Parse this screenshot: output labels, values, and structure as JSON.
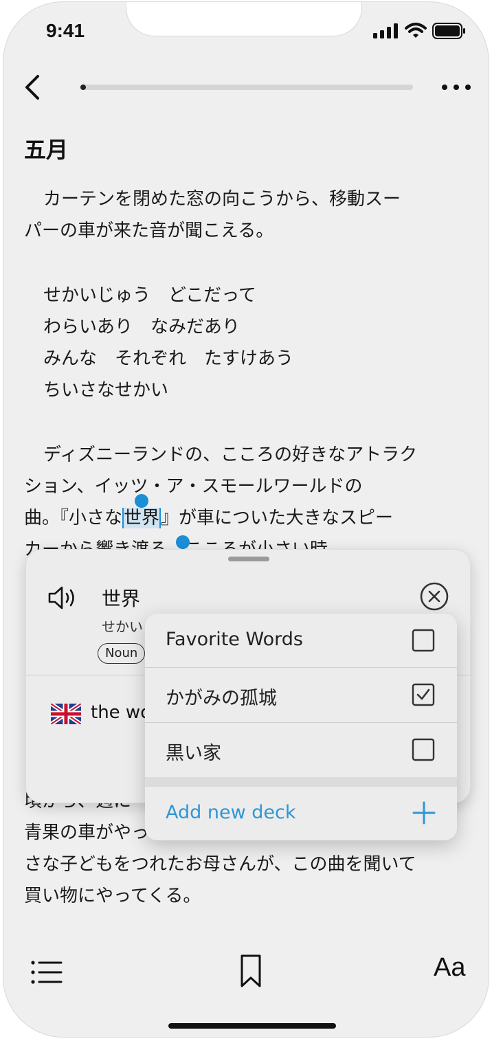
{
  "status": {
    "time": "9:41"
  },
  "reader": {
    "progress": 0.01,
    "chapter_title": "五月",
    "paragraph1": [
      "カーテンを閉めた窓の向こうから、移動スー",
      "パーの車が来た音が聞こえる。"
    ],
    "poem": [
      "せかいじゅう　どこだって",
      "わらいあり　なみだあり",
      "みんな　それぞれ　たすけあう",
      "ちいさなせかい"
    ],
    "paragraph2": {
      "line1": "ディズニーランドの、こころの好きなアトラク",
      "line2": "ション、イッツ・ア・スモールワールドの",
      "line3_before": "曲。『小さな",
      "line3_selected": "世界",
      "line3_after": "』が車についた大きなスピー",
      "line4": "カーから響き渡る。こころが小さい時"
    },
    "paragraph3": [
      "頃から、週に",
      "青果の車がやってくる。近所に住むお年寄りや小",
      "さな子どもをつれたお母さんが、この曲を聞いて",
      "買い物にやってくる。"
    ]
  },
  "dictionary": {
    "word": "世界",
    "reading": "せかい",
    "part_of_speech": "Noun",
    "meaning": "the world"
  },
  "deck_menu": {
    "decks": [
      {
        "label": "Favorite Words",
        "checked": false
      },
      {
        "label": "かがみの孤城",
        "checked": true
      },
      {
        "label": "黒い家",
        "checked": false
      }
    ],
    "add_label": "Add new deck"
  },
  "toolbar": {
    "font_label": "Aa"
  },
  "colors": {
    "accent": "#1d8fd6",
    "link": "#2c97d6",
    "background": "#efefef"
  }
}
